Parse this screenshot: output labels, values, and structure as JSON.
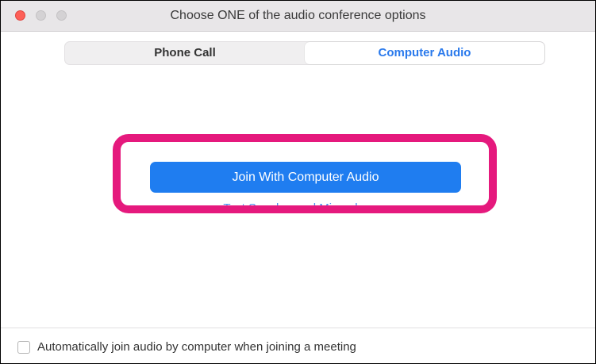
{
  "window": {
    "title": "Choose ONE of the audio conference options"
  },
  "tabs": [
    {
      "label": "Phone Call",
      "selected": false
    },
    {
      "label": "Computer Audio",
      "selected": true
    }
  ],
  "main": {
    "join_button_label": "Join With Computer Audio",
    "test_link_label": "Test Speaker and Microphone"
  },
  "footer": {
    "auto_join_label": "Automatically join audio by computer when joining a meeting",
    "auto_join_checked": false
  },
  "colors": {
    "accent": "#1f7df0",
    "highlight": "#e5197d",
    "close_button": "#fd5f57"
  },
  "icons": {
    "close": "traffic-light-close-icon",
    "minimize": "traffic-light-minimize-icon",
    "maximize": "traffic-light-maximize-icon"
  }
}
